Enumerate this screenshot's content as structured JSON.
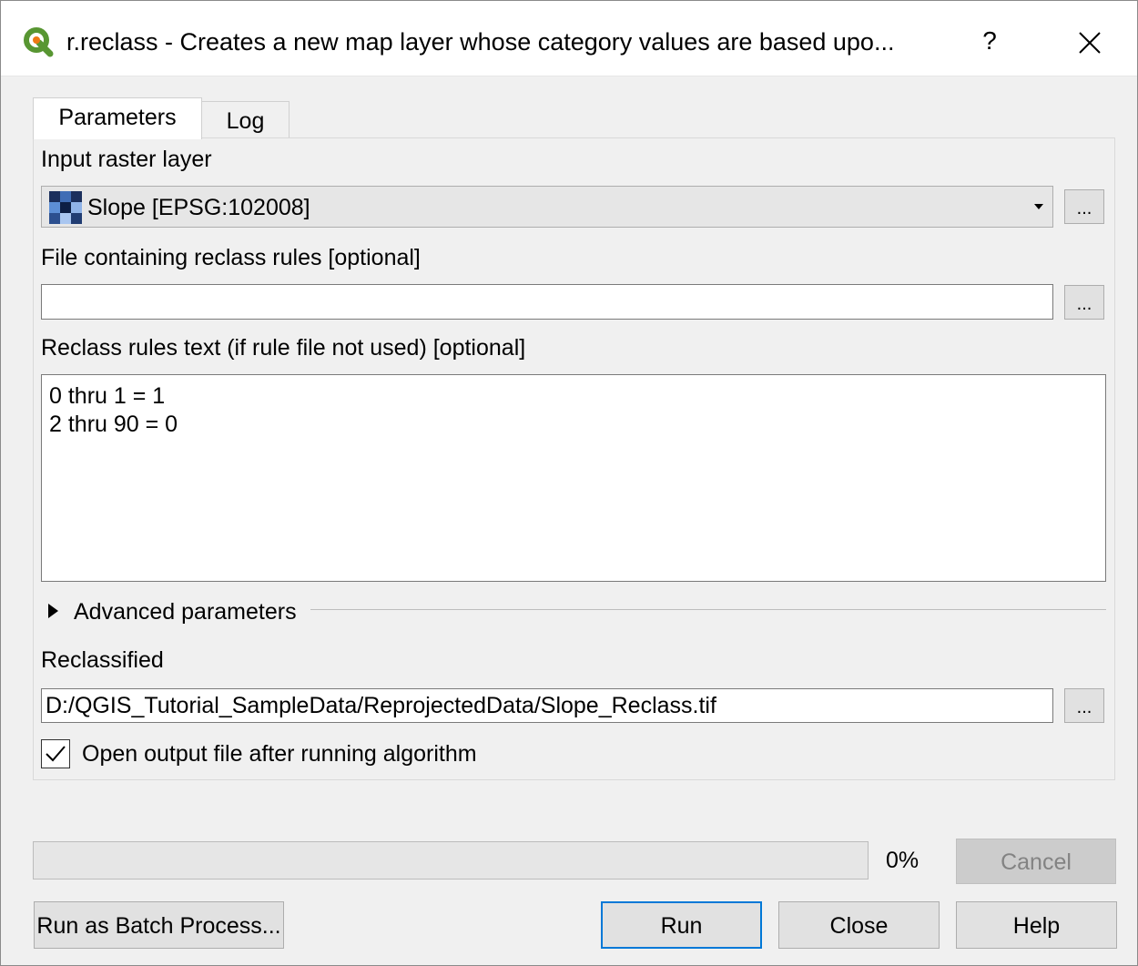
{
  "window": {
    "title": "r.reclass - Creates a new map layer whose category values are based upo...",
    "help_glyph": "?",
    "close_icon": "close-icon"
  },
  "tabs": [
    {
      "label": "Parameters",
      "active": true
    },
    {
      "label": "Log",
      "active": false
    }
  ],
  "params": {
    "input_raster_label": "Input raster layer",
    "input_raster_value": "Slope [EPSG:102008]",
    "input_raster_icon": "raster-layer-icon",
    "rules_file_label": "File containing reclass rules [optional]",
    "rules_file_value": "",
    "rules_text_label": "Reclass rules text (if rule file not used) [optional]",
    "rules_text_lines": [
      "0 thru 1 = 1",
      "2 thru 90 = 0"
    ],
    "advanced_label": "Advanced parameters",
    "output_label": "Reclassified",
    "output_value": "D:/QGIS_Tutorial_SampleData/ReprojectedData/Slope_Reclass.tif",
    "open_output_label": "Open output file after running algorithm",
    "open_output_checked": true,
    "browse_label": "..."
  },
  "progress": {
    "percent_text": "0%",
    "value": 0
  },
  "buttons": {
    "cancel": "Cancel",
    "batch": "Run as Batch Process...",
    "run": "Run",
    "close": "Close",
    "help": "Help"
  },
  "colors": {
    "accent": "#0078d7",
    "qgis_green": "#589632",
    "qgis_yellow": "#ee7913"
  }
}
